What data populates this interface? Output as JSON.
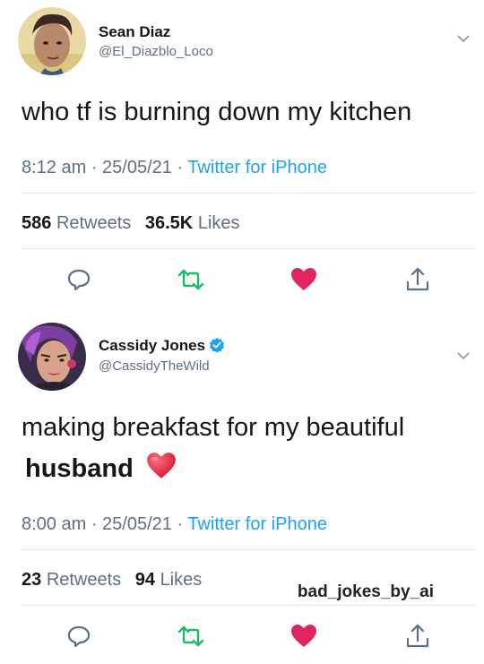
{
  "tweets": [
    {
      "name": "Sean Diaz",
      "handle": "@El_Diazblo_Loco",
      "verified": false,
      "text": "who tf is burning down my kitchen",
      "time": "8:12 am · 25/05/21 · ",
      "source": "Twitter for iPhone",
      "retweets_count": "586",
      "retweets_label": "Retweets",
      "likes_count": "36.5K",
      "likes_label": "Likes"
    },
    {
      "name": "Cassidy Jones",
      "handle": "@CassidyTheWild",
      "verified": true,
      "text_line1": "making breakfast for my beautiful",
      "text_line2": "husband",
      "emoji": "heart",
      "time": "8:00 am · 25/05/21 · ",
      "source": "Twitter for iPhone",
      "retweets_count": "23",
      "retweets_label": "Retweets",
      "likes_count": "94",
      "likes_label": "Likes"
    }
  ],
  "watermark": "bad_jokes_by_ai",
  "icons": [
    "chevron-down-icon",
    "reply-icon",
    "retweet-icon",
    "like-icon",
    "share-icon",
    "verified-badge-icon"
  ],
  "colors": {
    "link": "#1da1f2",
    "secondary_text": "#5b7083",
    "retweet_green": "#17bf63",
    "like_red": "#e0245e",
    "verified_blue": "#1da1f2"
  }
}
